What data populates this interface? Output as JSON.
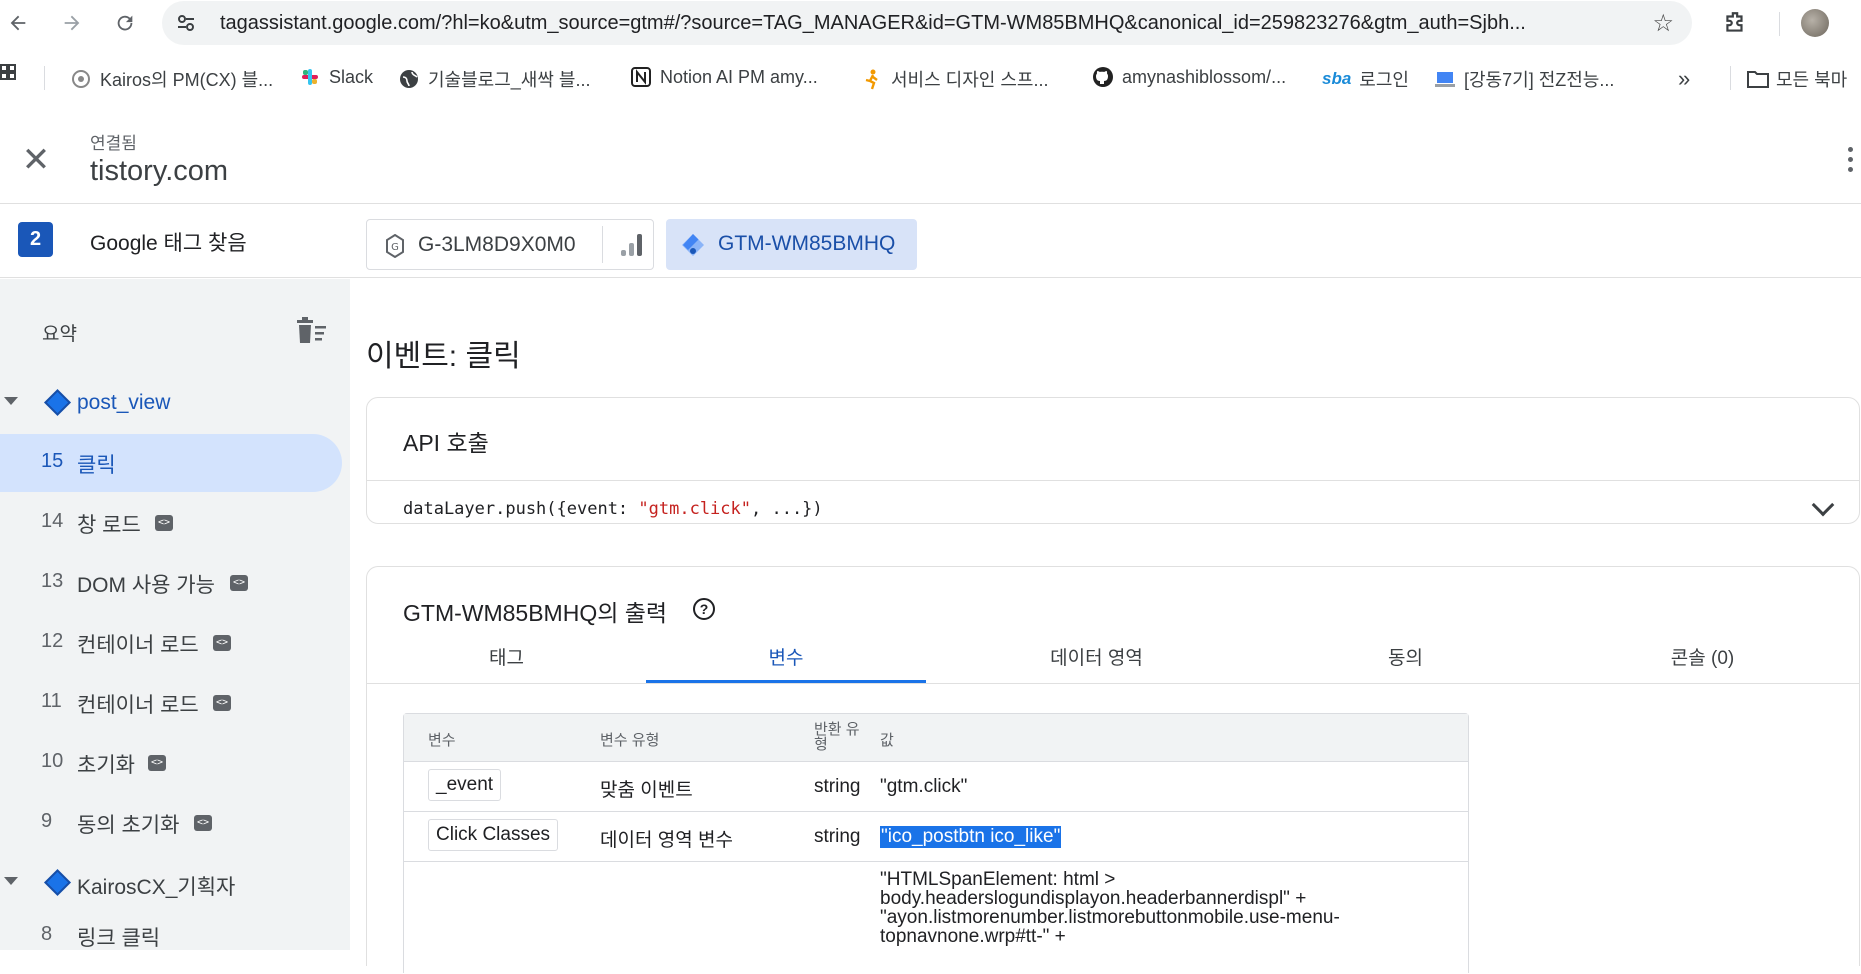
{
  "browser": {
    "url": "tagassistant.google.com/?hl=ko&utm_source=gtm#/?source=TAG_MANAGER&id=GTM-WM85BMHQ&canonical_id=259823276&gtm_auth=Sjbh...",
    "bookmarks": [
      {
        "label": "Kairos의 PM(CX) 블...",
        "icon": "kairos-icon"
      },
      {
        "label": "Slack",
        "icon": "slack-icon"
      },
      {
        "label": "기술블로그_새싹 블...",
        "icon": "globe-icon"
      },
      {
        "label": "Notion AI PM amy...",
        "icon": "notion-icon"
      },
      {
        "label": "서비스 디자인 스프...",
        "icon": "runner-icon"
      },
      {
        "label": "amynashiblossom/...",
        "icon": "github-icon"
      },
      {
        "label": "로그인",
        "icon": "sba-icon"
      },
      {
        "label": "[강동7기] 전Z전능...",
        "icon": "laptop-icon"
      }
    ],
    "bookmarks_more": "»",
    "all_bookmarks": "모든 북마",
    "sba_text": "sba"
  },
  "header": {
    "connected_label": "연결됨",
    "domain": "tistory.com"
  },
  "tags": {
    "count": "2",
    "found_label": "Google 태그 찾음",
    "ga_id": "G-3LM8D9X0M0",
    "gtm_id": "GTM-WM85BMHQ"
  },
  "sidebar": {
    "summary": "요약",
    "groups": [
      {
        "name": "post_view"
      },
      {
        "name": "KairosCX_기획자"
      }
    ],
    "events": [
      {
        "num": "15",
        "name": "클릭",
        "active": true
      },
      {
        "num": "14",
        "name": "창 로드"
      },
      {
        "num": "13",
        "name": "DOM 사용 가능"
      },
      {
        "num": "12",
        "name": "컨테이너 로드"
      },
      {
        "num": "11",
        "name": "컨테이너 로드"
      },
      {
        "num": "10",
        "name": "초기화"
      },
      {
        "num": "9",
        "name": "동의 초기화"
      },
      {
        "num": "8",
        "name": "링크 클릭"
      }
    ]
  },
  "main": {
    "event_title": "이벤트: 클릭",
    "api_title": "API 호출",
    "api_code_prefix": "dataLayer.push({event: ",
    "api_code_string": "\"gtm.click\"",
    "api_code_suffix": ", ...})",
    "output_title": "GTM-WM85BMHQ의 출력",
    "tabs": [
      "태그",
      "변수",
      "데이터 영역",
      "동의",
      "콘솔 (0)"
    ],
    "active_tab": "변수",
    "table": {
      "headers": [
        "변수",
        "변수 유형",
        "반환 유형",
        "값"
      ],
      "rows": [
        {
          "variable": "_event",
          "type": "맞춤 이벤트",
          "return": "string",
          "value": "\"gtm.click\""
        },
        {
          "variable": "Click Classes",
          "type": "데이터 영역 변수",
          "return": "string",
          "value": "\"ico_postbtn ico_like\""
        },
        {
          "variable": "",
          "type": "",
          "return": "",
          "value": "\"HTMLSpanElement: html > body.headerslogundisplayon.headerbannerdispl\" + \"ayon.listmorenumber.listmorebuttonmobile.use-menu-topnavnone.wrp#tt-\" +"
        }
      ]
    }
  }
}
